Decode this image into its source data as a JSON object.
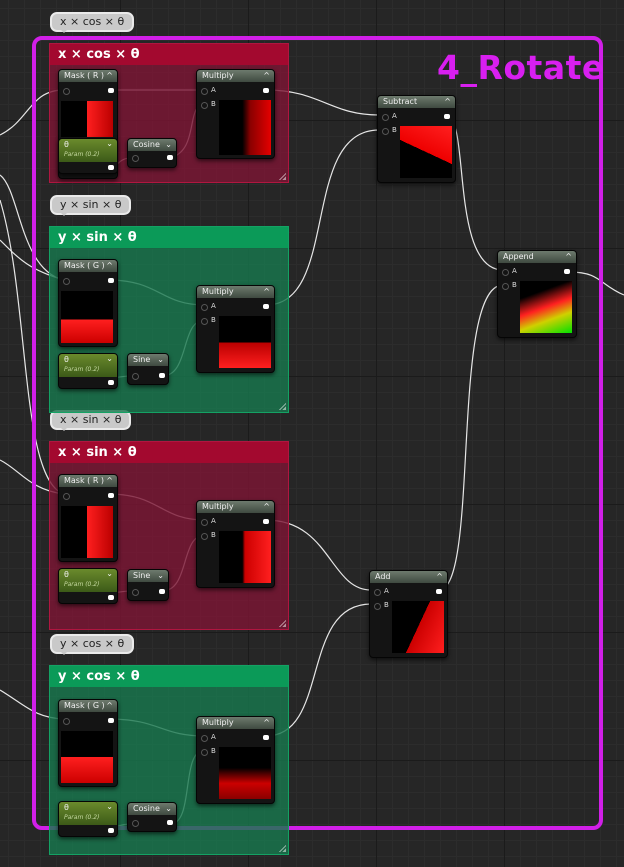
{
  "group": {
    "title": "4_Rotate",
    "accent": "#d11fe8"
  },
  "comments": [
    {
      "title": "x × cos × θ",
      "bubble": "x × cos × θ",
      "color": "red"
    },
    {
      "title": "y × sin × θ",
      "bubble": "y × sin × θ",
      "color": "green"
    },
    {
      "title": "x × sin × θ",
      "bubble": "x × sin × θ",
      "color": "red"
    },
    {
      "title": "y × cos × θ",
      "bubble": "y × cos × θ",
      "color": "green"
    }
  ],
  "nodes": {
    "mask_r1": {
      "label": "Mask ( R )"
    },
    "param1": {
      "label": "θ",
      "sub": "Param (0.2)"
    },
    "cos1": {
      "label": "Cosine"
    },
    "mul1": {
      "label": "Multiply",
      "pin_a": "A",
      "pin_b": "B"
    },
    "mask_g1": {
      "label": "Mask ( G )"
    },
    "param2": {
      "label": "θ",
      "sub": "Param (0.2)"
    },
    "sin1": {
      "label": "Sine"
    },
    "mul2": {
      "label": "Multiply",
      "pin_a": "A",
      "pin_b": "B"
    },
    "mask_r2": {
      "label": "Mask ( R )"
    },
    "param3": {
      "label": "θ",
      "sub": "Param (0.2)"
    },
    "sin2": {
      "label": "Sine"
    },
    "mul3": {
      "label": "Multiply",
      "pin_a": "A",
      "pin_b": "B"
    },
    "mask_g2": {
      "label": "Mask ( G )"
    },
    "param4": {
      "label": "θ",
      "sub": "Param (0.2)"
    },
    "cos2": {
      "label": "Cosine"
    },
    "mul4": {
      "label": "Multiply",
      "pin_a": "A",
      "pin_b": "B"
    },
    "subtract": {
      "label": "Subtract",
      "pin_a": "A",
      "pin_b": "B"
    },
    "add": {
      "label": "Add",
      "pin_a": "A",
      "pin_b": "B"
    },
    "append": {
      "label": "Append",
      "pin_a": "A",
      "pin_b": "B"
    }
  },
  "icons": {
    "collapse": "chevron-up-icon",
    "dropdown": "chevron-down-icon"
  }
}
